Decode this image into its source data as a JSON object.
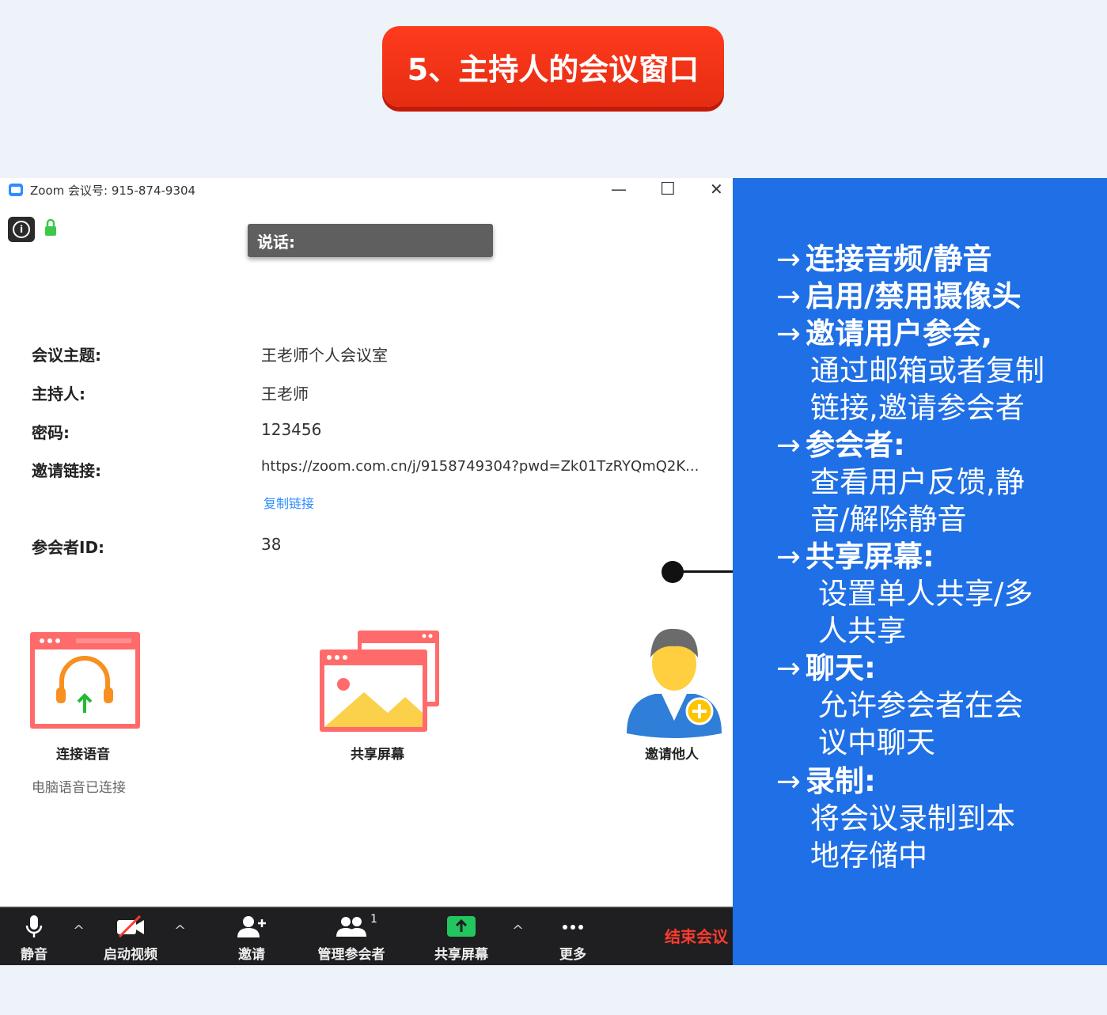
{
  "header": {
    "title": "5、主持人的会议窗口"
  },
  "window": {
    "title": "Zoom 会议号: 915-874-9304",
    "controls": {
      "minimize": "—",
      "maximize": "☐",
      "close": "✕"
    },
    "speaking": "说话:",
    "info": [
      {
        "label": "会议主题:",
        "value": "王老师个人会议室"
      },
      {
        "label": "主持人:",
        "value": "王老师"
      },
      {
        "label": "密码:",
        "value": "123456"
      },
      {
        "label": "邀请链接:",
        "value": "https://zoom.com.cn/j/9158749304?pwd=Zk01TzRYQmQ2K..."
      },
      {
        "label": "参会者ID:",
        "value": "38"
      }
    ],
    "copy_link": "复制链接",
    "features": {
      "audio": "连接语音",
      "share": "共享屏幕",
      "invite": "邀请他人"
    },
    "audio_status": "电脑语音已连接",
    "toolbar": {
      "mute": "静音",
      "video": "启动视频",
      "invite": "邀请",
      "participants": "管理参会者",
      "participants_count": "1",
      "share": "共享屏幕",
      "more": "更多",
      "end": "结束会议",
      "caret": "^"
    }
  },
  "panel": {
    "arrow": "→",
    "items": [
      {
        "head": "连接音频/静音",
        "sub": []
      },
      {
        "head": "启用/禁用摄像头",
        "sub": []
      },
      {
        "head": "邀请用户参会,",
        "sub": [
          "通过邮箱或者复制",
          "链接,邀请参会者"
        ]
      },
      {
        "head": "参会者:",
        "sub": [
          "查看用户反馈,静",
          "音/解除静音"
        ]
      },
      {
        "head": "共享屏幕:",
        "sub": [
          "设置单人共享/多",
          "人共享"
        ]
      },
      {
        "head": "聊天:",
        "sub": [
          "允许参会者在会",
          "议中聊天"
        ]
      },
      {
        "head": "录制:",
        "sub": [
          "将会议录制到本",
          "地存储中"
        ]
      }
    ]
  },
  "colors": {
    "badge": "#e52c12",
    "panel": "#1f6fe6",
    "toolbar": "#1f1f21",
    "end_meeting": "#ff3b30",
    "link": "#2d8cff"
  }
}
